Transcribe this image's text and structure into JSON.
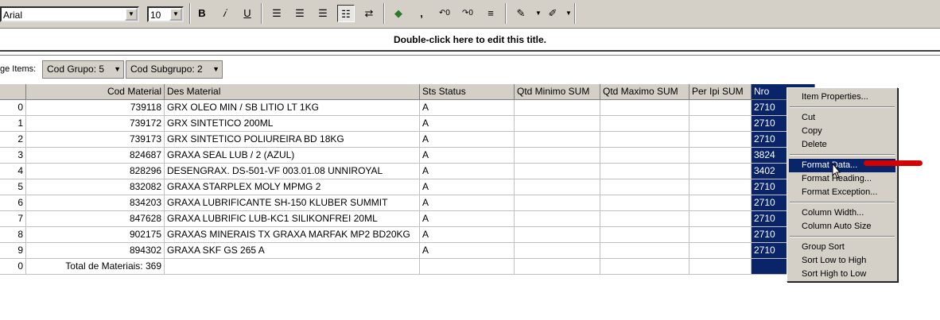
{
  "toolbar": {
    "font_name": "Arial",
    "font_size": "10",
    "bold_label": "B",
    "italic_label": "𝑖",
    "underline_label": "U"
  },
  "title": "Double-click here to edit this title.",
  "page_items": {
    "label": "ge Items:",
    "items": [
      "Cod Grupo: 5",
      "Cod Subgrupo: 2"
    ]
  },
  "grid": {
    "headers": [
      "Cod Material",
      "Des Material",
      "Sts Status",
      "Qtd Minimo SUM",
      "Qtd Maximo SUM",
      "Per Ipi SUM",
      "Nro"
    ],
    "rows": [
      {
        "idx": "0",
        "cod": "739118",
        "des": "GRX OLEO MIN / SB LITIO LT 1KG",
        "sts": "A",
        "nro": "2710"
      },
      {
        "idx": "1",
        "cod": "739172",
        "des": "GRX SINTETICO 200ML",
        "sts": "A",
        "nro": "2710"
      },
      {
        "idx": "2",
        "cod": "739173",
        "des": "GRX SINTETICO POLIUREIRA BD 18KG",
        "sts": "A",
        "nro": "2710"
      },
      {
        "idx": "3",
        "cod": "824687",
        "des": "GRAXA SEAL LUB / 2 (AZUL)",
        "sts": "A",
        "nro": "3824"
      },
      {
        "idx": "4",
        "cod": "828296",
        "des": "DESENGRAX. DS-501-VF 003.01.08 UNNIROYAL",
        "sts": "A",
        "nro": "3402"
      },
      {
        "idx": "5",
        "cod": "832082",
        "des": "GRAXA STARPLEX MOLY MPMG 2",
        "sts": "A",
        "nro": "2710"
      },
      {
        "idx": "6",
        "cod": "834203",
        "des": "GRAXA LUBRIFICANTE SH-150 KLUBER SUMMIT",
        "sts": "A",
        "nro": "2710"
      },
      {
        "idx": "7",
        "cod": "847628",
        "des": "GRAXA LUBRIFIC LUB-KC1 SILIKONFREI 20ML",
        "sts": "A",
        "nro": "2710"
      },
      {
        "idx": "8",
        "cod": "902175",
        "des": "GRAXAS MINERAIS TX GRAXA MARFAK MP2 BD20KG",
        "sts": "A",
        "nro": "2710"
      },
      {
        "idx": "9",
        "cod": "894302",
        "des": "GRAXA SKF GS 265 A",
        "sts": "A",
        "nro": "2710"
      }
    ],
    "total": {
      "idx": "0",
      "label": "Total de Materiais: 369"
    }
  },
  "context_menu": {
    "groups": [
      [
        "Item Properties..."
      ],
      [
        "Cut",
        "Copy",
        "Delete"
      ],
      [
        "Format Data...",
        "Format Heading...",
        "Format Exception..."
      ],
      [
        "Column Width...",
        "Column Auto Size"
      ],
      [
        "Group Sort",
        "Sort Low to High",
        "Sort High to Low"
      ]
    ],
    "highlighted": "Format Data..."
  }
}
